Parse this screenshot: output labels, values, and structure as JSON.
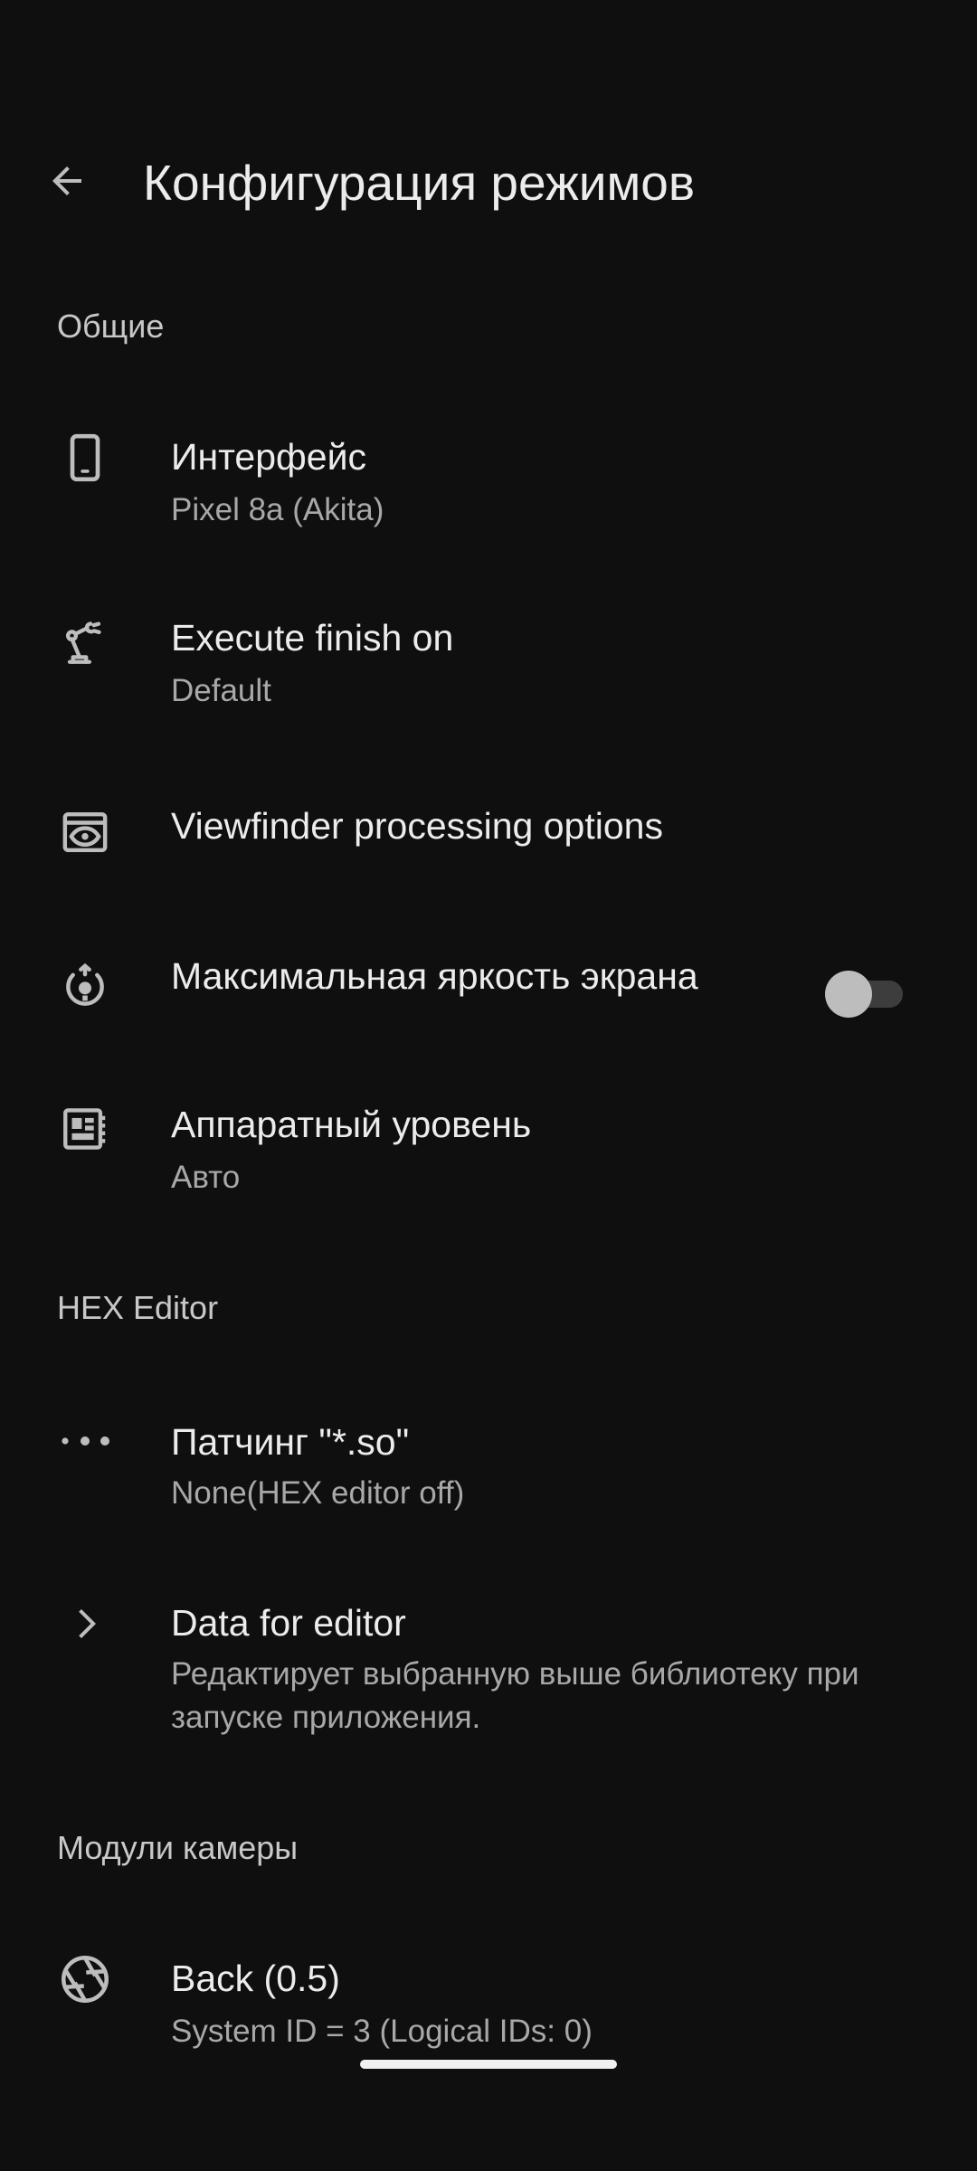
{
  "header": {
    "title": "Конфигурация режимов"
  },
  "sections": {
    "general": "Общие",
    "hex_editor": "HEX Editor",
    "camera_modules": "Модули камеры"
  },
  "items": {
    "interface": {
      "title": "Интерфейс",
      "subtitle": "Pixel 8a (Akita)",
      "icon": "phone-icon"
    },
    "execute_finish": {
      "title": "Execute finish on",
      "subtitle": "Default",
      "icon": "robot-arm-icon"
    },
    "viewfinder": {
      "title": "Viewfinder processing options",
      "icon": "preview-eye-icon"
    },
    "max_brightness": {
      "title": "Максимальная яркость экрана",
      "icon": "brightness-auto-icon",
      "toggle_on": false
    },
    "hardware_level": {
      "title": "Аппаратный уровень",
      "subtitle": "Авто",
      "icon": "chip-board-icon"
    },
    "patching": {
      "title": "Патчинг \"*.so\"",
      "subtitle": "None(HEX editor off)",
      "icon": "more-dots-icon"
    },
    "data_for_editor": {
      "title": "Data for editor",
      "subtitle": "Редактирует выбранную выше библиотеку при запуске приложения.",
      "icon": "chevron-right-icon"
    },
    "back_camera": {
      "title": "Back  (0.5)",
      "subtitle": "System ID = 3  (Logical IDs:  0)",
      "icon": "camera-aperture-icon"
    }
  },
  "colors": {
    "background": "#0f0f0f",
    "text_primary": "#ececec",
    "text_secondary": "#a8a8a8",
    "icon": "#bdbdbd"
  }
}
